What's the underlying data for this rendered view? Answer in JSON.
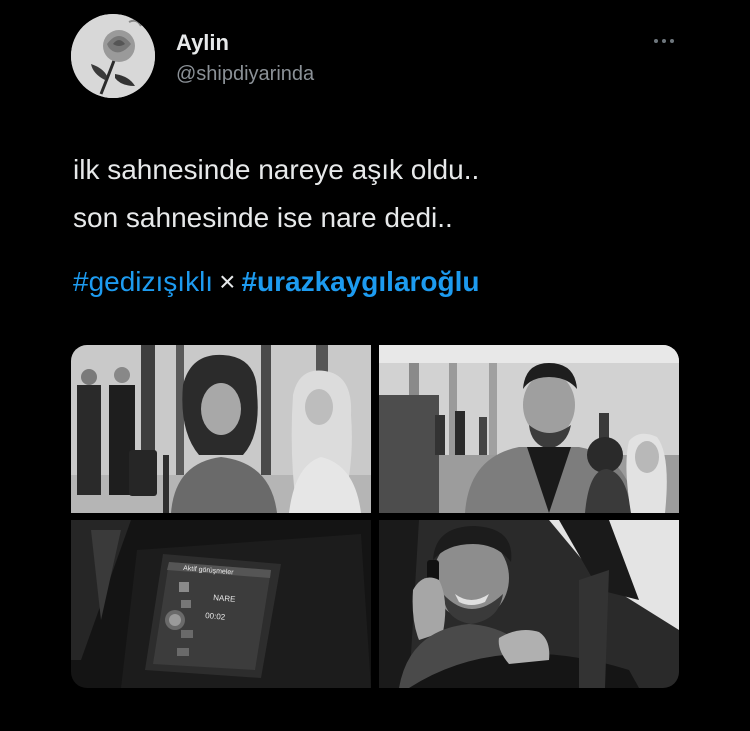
{
  "user": {
    "display_name": "Aylin",
    "handle": "@shipdiyarinda",
    "avatar_icon": "rose-icon"
  },
  "more_icon": "more-horizontal-icon",
  "tweet": {
    "lines": [
      "ilk sahnesinde nareye aşık oldu..",
      "son sahnesinde ise nare dedi.."
    ],
    "hashtag_1": "#gedizışıklı",
    "separator": "×",
    "hashtag_2": "#urazkaygılaroğlu"
  },
  "media": {
    "car_screen_title": "Aktif görüşmeler",
    "car_screen_contact": "NARE",
    "car_screen_time": "00:02"
  },
  "colors": {
    "link": "#1d9bf0",
    "background": "#000000",
    "text": "#e7e9ea",
    "secondary": "#8b9197"
  }
}
